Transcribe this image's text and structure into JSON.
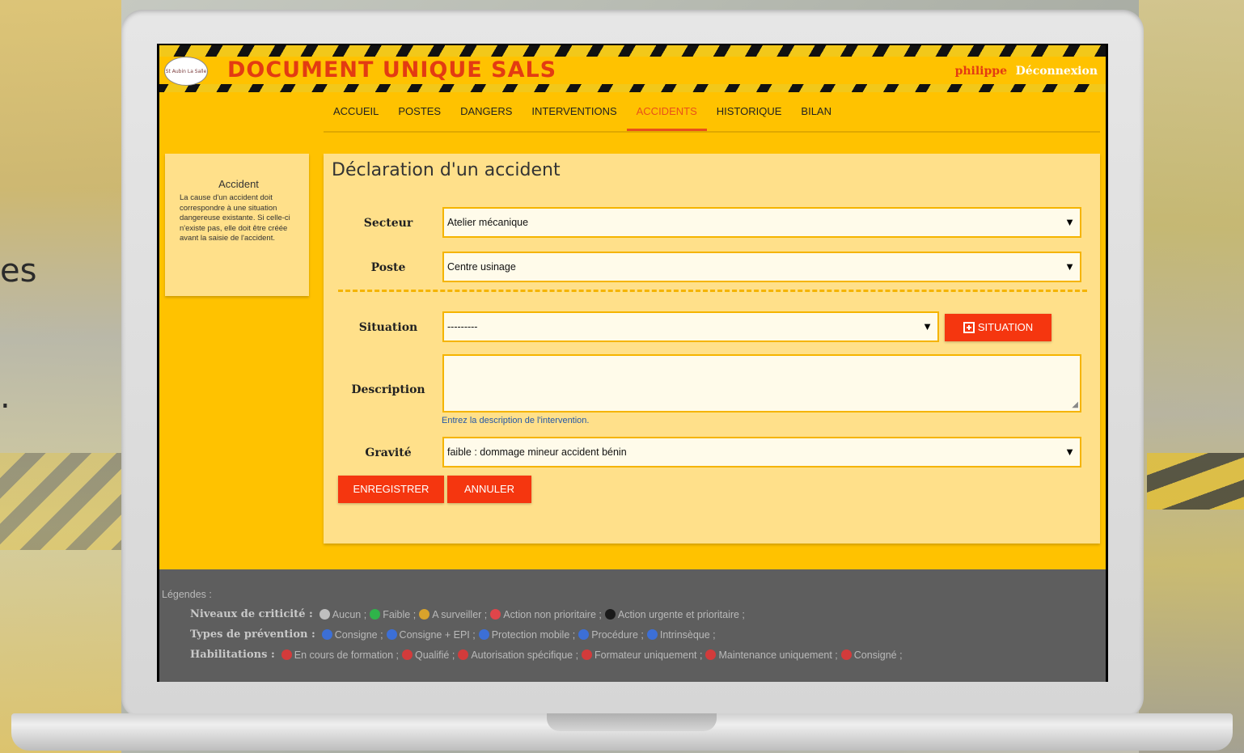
{
  "background": {
    "side_text_1": "es",
    "side_text_2": "."
  },
  "header": {
    "app_title": "DOCUMENT UNIQUE SALS",
    "logo_text": "St Aubin La Salle",
    "user": "philippe",
    "logout": "Déconnexion"
  },
  "nav": {
    "items": [
      "ACCUEIL",
      "POSTES",
      "DANGERS",
      "INTERVENTIONS",
      "ACCIDENTS",
      "HISTORIQUE",
      "BILAN"
    ],
    "active": "ACCIDENTS"
  },
  "help": {
    "title": "Accident",
    "text": "La cause d'un accident doit correspondre à une situation dangereuse existante. Si celle-ci n'existe pas, elle doit être créée avant la saisie de l'accident."
  },
  "form": {
    "title": "Déclaration d'un accident",
    "secteur": {
      "label": "Secteur",
      "value": "Atelier mécanique"
    },
    "poste": {
      "label": "Poste",
      "value": "Centre usinage"
    },
    "situation": {
      "label": "Situation",
      "value": "---------",
      "add_button": "SITUATION"
    },
    "description": {
      "label": "Description",
      "value": "",
      "hint": "Entrez la description de l'intervention."
    },
    "gravite": {
      "label": "Gravité",
      "value": "faible : dommage mineur accident bénin"
    },
    "save_button": "ENREGISTRER",
    "cancel_button": "ANNULER"
  },
  "legend": {
    "title": "Légendes :",
    "criticite": {
      "label": "Niveaux de criticité :",
      "items": [
        {
          "text": "Aucun ;",
          "color": "#bfbfbf"
        },
        {
          "text": "Faible ;",
          "color": "#2fb34a"
        },
        {
          "text": "A surveiller ;",
          "color": "#d9a32b"
        },
        {
          "text": "Action non prioritaire ;",
          "color": "#e0454a"
        },
        {
          "text": "Action urgente et prioritaire ;",
          "color": "#1a1a1a"
        }
      ]
    },
    "prevention": {
      "label": "Types de prévention :",
      "items": [
        {
          "text": "Consigne ;",
          "color": "#3c6fd6"
        },
        {
          "text": "Consigne + EPI ;",
          "color": "#3c6fd6"
        },
        {
          "text": "Protection mobile ;",
          "color": "#3c6fd6"
        },
        {
          "text": "Procédure ;",
          "color": "#3c6fd6"
        },
        {
          "text": "Intrinsèque ;",
          "color": "#3c6fd6"
        }
      ]
    },
    "habilitations": {
      "label": "Habilitations :",
      "items": [
        {
          "text": "En cours de formation ;",
          "color": "#d23b3b"
        },
        {
          "text": "Qualifié ;",
          "color": "#d23b3b"
        },
        {
          "text": "Autorisation spécifique ;",
          "color": "#d23b3b"
        },
        {
          "text": "Formateur uniquement ;",
          "color": "#d23b3b"
        },
        {
          "text": "Maintenance uniquement ;",
          "color": "#d23b3b"
        },
        {
          "text": "Consigné ;",
          "color": "#d23b3b"
        }
      ]
    }
  }
}
